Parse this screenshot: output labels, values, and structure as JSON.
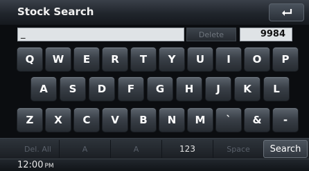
{
  "title": "Stock Search",
  "search": {
    "value": "_",
    "placeholder": ""
  },
  "delete_label": "Delete",
  "result_count": "9984",
  "keyboard": {
    "row1": [
      "Q",
      "W",
      "E",
      "R",
      "T",
      "Y",
      "U",
      "I",
      "O",
      "P"
    ],
    "row2": [
      "A",
      "S",
      "D",
      "F",
      "G",
      "H",
      "J",
      "K",
      "L"
    ],
    "row3": [
      "Z",
      "X",
      "C",
      "V",
      "B",
      "N",
      "M",
      "`",
      "&",
      "-"
    ]
  },
  "function_bar": {
    "del_all": "Del. All",
    "shift_1": "A",
    "shift_2": "A",
    "numeric": "123",
    "space": "Space",
    "search": "Search"
  },
  "status": {
    "time": "12:00",
    "ampm": "PM"
  },
  "icons": {
    "back": "return-arrow-icon"
  }
}
